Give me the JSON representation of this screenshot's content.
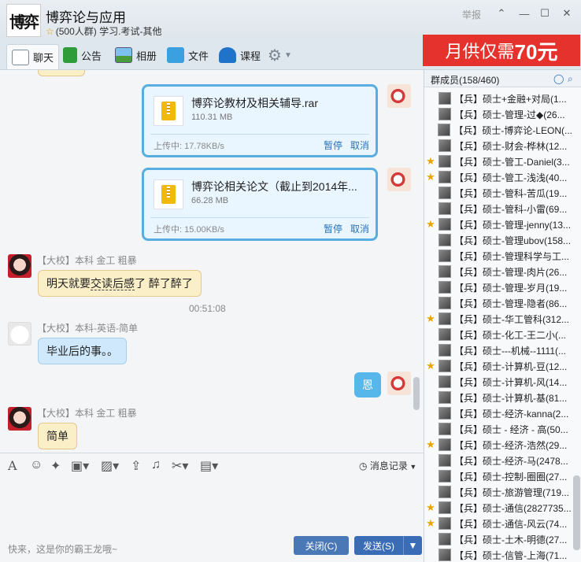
{
  "window": {
    "logo_text": "博弈",
    "title": "博弈论与应用",
    "subtitle": "(500人群) 学习.考试-其他",
    "report_label": "举报",
    "controls": [
      "⌃",
      "—",
      "☐",
      "✕"
    ]
  },
  "toolbar": {
    "items": [
      "聊天",
      "公告",
      "相册",
      "文件",
      "课程"
    ]
  },
  "ad": {
    "text": "月供仅需",
    "amount": "70元"
  },
  "chat": {
    "files": [
      {
        "name": "博弈论教材及相关辅导.rar",
        "size": "110.31 MB",
        "speed": "上传中: 17.78KB/s",
        "pause": "暂停",
        "cancel": "取消"
      },
      {
        "name": "博弈论相关论文（截止到2014年...",
        "size": "66.28 MB",
        "speed": "上传中: 15.00KB/s",
        "pause": "暂停",
        "cancel": "取消"
      }
    ],
    "messages": [
      {
        "sender": "【大校】本科 金工 粗暴",
        "text_pre": "明天就要",
        "text_dash": "交读后感",
        "text_post": "了  醉了醉了"
      },
      {
        "time": "00:51:08"
      },
      {
        "sender": "【大校】本科-英语-简单",
        "text": "毕业后的事。。"
      },
      {
        "mine": true,
        "text": "恩"
      },
      {
        "sender": "【大校】本科 金工 粗暴",
        "text": "简单"
      }
    ]
  },
  "input": {
    "history_label": "消息记录",
    "placeholder": "快来，这是你的霸王龙哦~",
    "close_label": "关闭(C)",
    "send_label": "发送(S)"
  },
  "members": {
    "header": "群成员(158/460)",
    "list": [
      {
        "star": false,
        "name": "【兵】硕士+金融+对局(1..."
      },
      {
        "star": false,
        "name": "【兵】硕士-管理-过◆(26..."
      },
      {
        "star": false,
        "name": "【兵】硕士-博弈论-LEON(..."
      },
      {
        "star": false,
        "name": "【兵】硕士-财会-桦林(12..."
      },
      {
        "star": true,
        "name": "【兵】硕士-管工-Daniel(3..."
      },
      {
        "star": true,
        "name": "【兵】硕士-管工-浅浅(40..."
      },
      {
        "star": false,
        "name": "【兵】硕士-管科-苦瓜(19..."
      },
      {
        "star": false,
        "name": "【兵】硕士-管科-小雷(69..."
      },
      {
        "star": true,
        "name": "【兵】硕士-管理-jenny(13..."
      },
      {
        "star": false,
        "name": "【兵】硕士-管理ubov(158..."
      },
      {
        "star": false,
        "name": "【兵】硕士-管理科学与工..."
      },
      {
        "star": false,
        "name": "【兵】硕士-管理-肉片(26..."
      },
      {
        "star": false,
        "name": "【兵】硕士-管理-岁月(19..."
      },
      {
        "star": false,
        "name": "【兵】硕士-管理-隐者(86..."
      },
      {
        "star": true,
        "name": "【兵】硕士-华工管科(312..."
      },
      {
        "star": false,
        "name": "【兵】硕士-化工-王二小(..."
      },
      {
        "star": false,
        "name": "【兵】硕士---机械--1111(..."
      },
      {
        "star": true,
        "name": "【兵】硕士-计算机-豆(12..."
      },
      {
        "star": false,
        "name": "【兵】硕士-计算机-风(14..."
      },
      {
        "star": false,
        "name": "【兵】硕士-计算机-基(81..."
      },
      {
        "star": false,
        "name": "【兵】硕士-经济-kanna(2..."
      },
      {
        "star": false,
        "name": "【兵】硕士 - 经济 - 高(50..."
      },
      {
        "star": true,
        "name": "【兵】硕士-经济-浩然(29..."
      },
      {
        "star": false,
        "name": "【兵】硕士-经济-马(2478..."
      },
      {
        "star": false,
        "name": "【兵】硕士-控制-圈圈(27..."
      },
      {
        "star": false,
        "name": "【兵】硕士-旅游管理(719..."
      },
      {
        "star": true,
        "name": "【兵】硕士-通信(2827735..."
      },
      {
        "star": true,
        "name": "【兵】硕士-通信-风云(74..."
      },
      {
        "star": false,
        "name": "【兵】硕士-土木-明德(27..."
      },
      {
        "star": false,
        "name": "【兵】硕士-信管-上海(71..."
      }
    ]
  }
}
